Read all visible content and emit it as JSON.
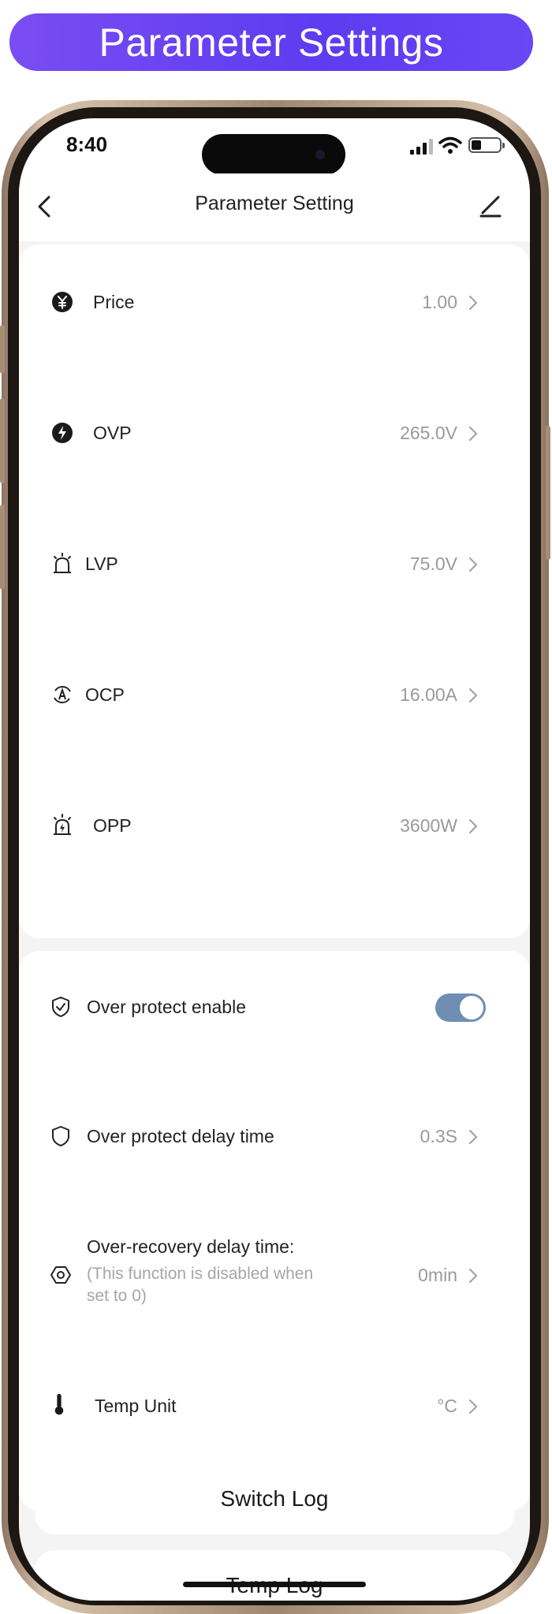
{
  "banner": {
    "title": "Parameter Settings"
  },
  "status_bar": {
    "time": "8:40"
  },
  "nav": {
    "title": "Parameter Setting"
  },
  "limits": [
    {
      "icon": "yen-coin-icon",
      "label": "Price",
      "value": "1.00"
    },
    {
      "icon": "voltage-alert-icon",
      "label": "OVP",
      "value": "265.0V"
    },
    {
      "icon": "alarm-light-icon",
      "label": "LVP",
      "value": "75.0V"
    },
    {
      "icon": "current-cycle-icon",
      "label": "OCP",
      "value": "16.00A"
    },
    {
      "icon": "power-alarm-icon",
      "label": "OPP",
      "value": "3600W"
    }
  ],
  "protection": {
    "enable": {
      "icon": "shield-check-icon",
      "label": "Over protect enable",
      "on": true
    },
    "delay": {
      "icon": "shield-icon",
      "label": "Over protect delay time",
      "value": "0.3S"
    },
    "recovery": {
      "icon": "hexagon-ring-icon",
      "label": "Over-recovery delay time:",
      "note_line1": "(This function is disabled when",
      "note_line2": "set to 0)",
      "value": "0min"
    },
    "temp_unit": {
      "icon": "thermometer-icon",
      "label": "Temp Unit",
      "value": "°C"
    }
  },
  "buttons": {
    "switch_log": "Switch Log",
    "temp_log": "Temp Log"
  },
  "colors": {
    "accent_toggle": "#6e8fb3",
    "banner_start": "#7a4cf3",
    "banner_end": "#5d3cf0"
  }
}
